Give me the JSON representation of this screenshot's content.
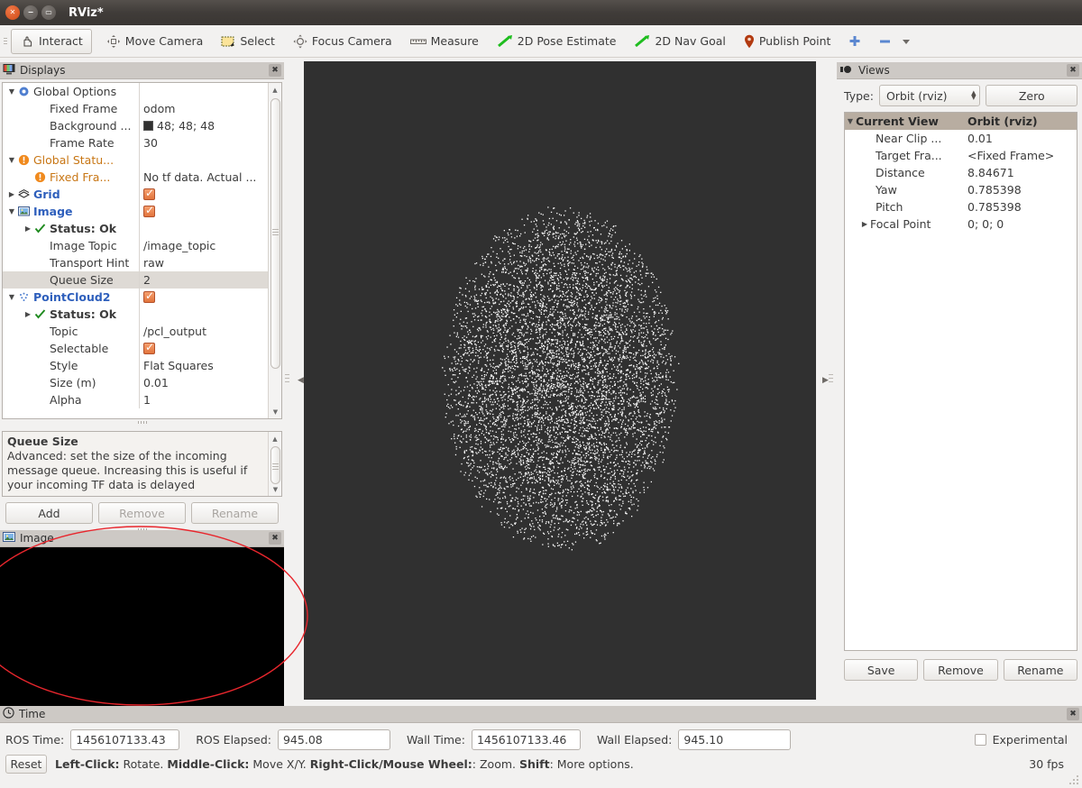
{
  "window": {
    "title": "RViz*",
    "close_label": "x",
    "minimize_label": "–",
    "maximize_label": "□"
  },
  "toolbar": {
    "items": [
      {
        "label": "Interact",
        "icon": "hand-cursor-icon",
        "active": true
      },
      {
        "label": "Move Camera",
        "icon": "move-camera-icon",
        "active": false
      },
      {
        "label": "Select",
        "icon": "select-rectangle-icon",
        "active": false
      },
      {
        "label": "Focus Camera",
        "icon": "focus-camera-icon",
        "active": false
      },
      {
        "label": "Measure",
        "icon": "ruler-icon",
        "active": false
      },
      {
        "label": "2D Pose Estimate",
        "icon": "green-arrow-icon",
        "active": false
      },
      {
        "label": "2D Nav Goal",
        "icon": "green-arrow-icon",
        "active": false
      },
      {
        "label": "Publish Point",
        "icon": "map-pin-icon",
        "active": false
      }
    ],
    "add_tool_label": "+",
    "remove_tool_label": "–"
  },
  "displays": {
    "title": "Displays",
    "rows": [
      {
        "indent": 0,
        "arrow": "▼",
        "icon": "gear-icon",
        "label": "Global Options",
        "label_style": "plain",
        "value": "",
        "value_type": "none"
      },
      {
        "indent": 1,
        "arrow": "",
        "icon": "",
        "label": "Fixed Frame",
        "label_style": "plain",
        "value": "odom",
        "value_type": "text"
      },
      {
        "indent": 1,
        "arrow": "",
        "icon": "",
        "label": "Background ...",
        "label_style": "plain",
        "value": "48; 48; 48",
        "value_type": "color",
        "color": "#303030"
      },
      {
        "indent": 1,
        "arrow": "",
        "icon": "",
        "label": "Frame Rate",
        "label_style": "plain",
        "value": "30",
        "value_type": "text"
      },
      {
        "indent": 0,
        "arrow": "▼",
        "icon": "warning-icon",
        "label": "Global Statu...",
        "label_style": "orange",
        "value": "",
        "value_type": "none"
      },
      {
        "indent": 1,
        "arrow": "",
        "icon": "warning-icon",
        "label": "Fixed Fra...",
        "label_style": "orange",
        "value": "No tf data.  Actual ...",
        "value_type": "text"
      },
      {
        "indent": 0,
        "arrow": "▶",
        "icon": "grid-icon",
        "label": "Grid",
        "label_style": "blue",
        "value": "",
        "value_type": "check"
      },
      {
        "indent": 0,
        "arrow": "▼",
        "icon": "image-icon",
        "label": "Image",
        "label_style": "blue",
        "value": "",
        "value_type": "check"
      },
      {
        "indent": 1,
        "arrow": "▶",
        "icon": "ok-check-icon",
        "label": "Status: Ok",
        "label_style": "bold",
        "value": "",
        "value_type": "none"
      },
      {
        "indent": 1,
        "arrow": "",
        "icon": "",
        "label": "Image Topic",
        "label_style": "plain",
        "value": "/image_topic",
        "value_type": "text"
      },
      {
        "indent": 1,
        "arrow": "",
        "icon": "",
        "label": "Transport Hint",
        "label_style": "plain",
        "value": "raw",
        "value_type": "text"
      },
      {
        "indent": 1,
        "arrow": "",
        "icon": "",
        "label": "Queue Size",
        "label_style": "plain",
        "value": "2",
        "value_type": "text",
        "selected": true
      },
      {
        "indent": 0,
        "arrow": "▼",
        "icon": "pointcloud-icon",
        "label": "PointCloud2",
        "label_style": "blue",
        "value": "",
        "value_type": "check"
      },
      {
        "indent": 1,
        "arrow": "▶",
        "icon": "ok-check-icon",
        "label": "Status: Ok",
        "label_style": "bold",
        "value": "",
        "value_type": "none"
      },
      {
        "indent": 1,
        "arrow": "",
        "icon": "",
        "label": "Topic",
        "label_style": "plain",
        "value": "/pcl_output",
        "value_type": "text"
      },
      {
        "indent": 1,
        "arrow": "",
        "icon": "",
        "label": "Selectable",
        "label_style": "plain",
        "value": "",
        "value_type": "check"
      },
      {
        "indent": 1,
        "arrow": "",
        "icon": "",
        "label": "Style",
        "label_style": "plain",
        "value": "Flat Squares",
        "value_type": "text"
      },
      {
        "indent": 1,
        "arrow": "",
        "icon": "",
        "label": "Size (m)",
        "label_style": "plain",
        "value": "0.01",
        "value_type": "text"
      },
      {
        "indent": 1,
        "arrow": "",
        "icon": "",
        "label": "Alpha",
        "label_style": "plain",
        "value": "1",
        "value_type": "text"
      }
    ],
    "description": {
      "title": "Queue Size",
      "body": "Advanced: set the size of the incoming message queue. Increasing this is useful if your incoming TF data is delayed"
    },
    "buttons": {
      "add": "Add",
      "remove": "Remove",
      "rename": "Rename"
    }
  },
  "image_panel": {
    "title": "Image"
  },
  "views": {
    "title": "Views",
    "type_label": "Type:",
    "type_value": "Orbit (rviz)",
    "zero_label": "Zero",
    "header": {
      "name": "Current View",
      "value": "Orbit (rviz)"
    },
    "rows": [
      {
        "indent": 1,
        "arrow": "",
        "label": "Near Clip ...",
        "value": "0.01"
      },
      {
        "indent": 1,
        "arrow": "",
        "label": "Target Fra...",
        "value": "<Fixed Frame>"
      },
      {
        "indent": 1,
        "arrow": "",
        "label": "Distance",
        "value": "8.84671"
      },
      {
        "indent": 1,
        "arrow": "",
        "label": "Yaw",
        "value": "0.785398"
      },
      {
        "indent": 1,
        "arrow": "",
        "label": "Pitch",
        "value": "0.785398"
      },
      {
        "indent": 0,
        "arrow": "▶",
        "label": "Focal Point",
        "value": "0; 0; 0"
      }
    ],
    "buttons": {
      "save": "Save",
      "remove": "Remove",
      "rename": "Rename"
    }
  },
  "time": {
    "title": "Time",
    "fields": [
      {
        "label": "ROS Time:",
        "value": "1456107133.43"
      },
      {
        "label": "ROS Elapsed:",
        "value": "945.08"
      },
      {
        "label": "Wall Time:",
        "value": "1456107133.46"
      },
      {
        "label": "Wall Elapsed:",
        "value": "945.10"
      }
    ],
    "experimental_label": "Experimental",
    "experimental_checked": false
  },
  "statusbar": {
    "reset_label": "Reset",
    "hint_parts": [
      {
        "text": "Left-Click:",
        "bold": true
      },
      {
        "text": " Rotate. ",
        "bold": false
      },
      {
        "text": "Middle-Click:",
        "bold": true
      },
      {
        "text": " Move X/Y. ",
        "bold": false
      },
      {
        "text": "Right-Click/Mouse Wheel:",
        "bold": true
      },
      {
        "text": ": Zoom. ",
        "bold": false
      },
      {
        "text": "Shift",
        "bold": true
      },
      {
        "text": ": More options.",
        "bold": false
      }
    ],
    "fps": "30 fps"
  },
  "viewport": {
    "background_color": "#303030",
    "grid_color": "#8f8f8f",
    "point_color": "#ffffff",
    "annotation_color": "#e8262d"
  }
}
